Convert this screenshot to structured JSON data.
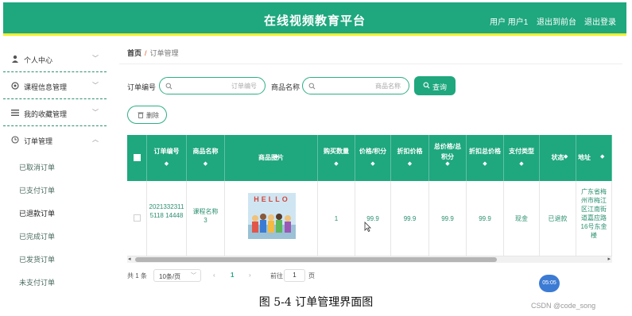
{
  "header": {
    "title": "在线视频教育平台",
    "user_label": "用户 用户1",
    "back_front": "退出到前台",
    "logout": "退出登录"
  },
  "sidebar": {
    "menus": [
      {
        "label": "个人中心",
        "icon": "person-icon"
      },
      {
        "label": "课程信息管理",
        "icon": "gear-icon"
      },
      {
        "label": "我的收藏管理",
        "icon": "list-icon"
      },
      {
        "label": "订单管理",
        "icon": "clock-icon"
      }
    ],
    "submenu": [
      "已取消订单",
      "已支付订单",
      "已退款订单",
      "已完成订单",
      "已发货订单",
      "未支付订单"
    ],
    "active_sub": "已退款订单"
  },
  "breadcrumb": {
    "home": "首页",
    "separator": "/",
    "current": "订单管理"
  },
  "filters": {
    "order_no_label": "订单编号",
    "order_no_placeholder": "订单编号",
    "product_label": "商品名称",
    "product_placeholder": "商品名称",
    "search_button": "查询",
    "delete_button": "删除"
  },
  "table": {
    "columns": [
      "订单编号",
      "商品名称",
      "商品图片",
      "购买数量",
      "价格/积分",
      "折扣价格",
      "总价格/总积分",
      "折扣总价格",
      "支付类型",
      "状态",
      "地址"
    ],
    "sort_indicator": "◆",
    "rows": [
      {
        "order_no": "20213323115118 14448",
        "product": "课程名称3",
        "image_text": "HELLO",
        "quantity": "1",
        "price": "99.9",
        "discount_price": "99.9",
        "total": "99.9",
        "discount_total": "99.9",
        "pay_type": "现金",
        "status": "已退款",
        "address": "广东省梅州市梅江区江南街道嘉应路16号东金楼"
      }
    ]
  },
  "pagination": {
    "total": "共 1 条",
    "page_size": "10条/页",
    "prev": "‹",
    "current_page": "1",
    "next": "›",
    "goto_label": "前往",
    "goto_value": "1",
    "page_suffix": "页"
  },
  "caption": "图 5-4 订单管理界面图",
  "watermark": "CSDN @code_song",
  "time_bubble": "05:05",
  "colors": {
    "primary": "#1fa77e",
    "accent_bar": "#f2ee2a",
    "link_text": "#2b8f70"
  }
}
